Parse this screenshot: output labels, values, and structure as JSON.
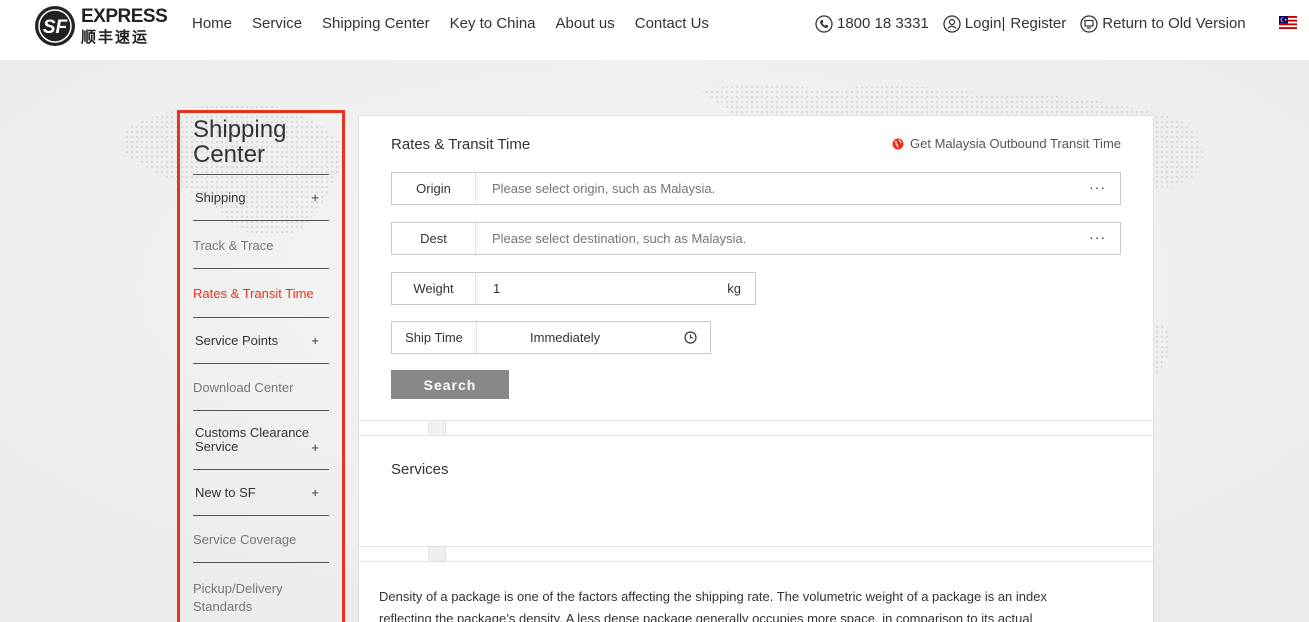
{
  "header": {
    "logo": {
      "en": "EXPRESS",
      "cn": "顺丰速运",
      "mark": "SF"
    },
    "nav": [
      "Home",
      "Service",
      "Shipping Center",
      "Key to China",
      "About us",
      "Contact Us"
    ],
    "phone": "1800 18 3331",
    "login": "Login|",
    "register": "Register",
    "old_version": "Return to Old Version",
    "icons": {
      "phone": "phone-icon",
      "user": "user-icon",
      "old": "monitor-icon",
      "flag": "malaysia-flag-icon"
    }
  },
  "sidebar": {
    "title": "Shipping Center",
    "items": [
      {
        "label": "Shipping",
        "plus": "+",
        "style": "dark"
      },
      {
        "label": "Track & Trace",
        "plus": "",
        "style": "grey"
      },
      {
        "label": "Rates & Transit Time",
        "plus": "",
        "style": "active"
      },
      {
        "label": "Service Points",
        "plus": "+",
        "style": "dark"
      },
      {
        "label": "Download Center",
        "plus": "",
        "style": "grey"
      },
      {
        "label": "Customs Clearance Service",
        "plus": "+",
        "style": "dark"
      },
      {
        "label": "New to SF",
        "plus": "+",
        "style": "dark"
      },
      {
        "label": "Service Coverage",
        "plus": "",
        "style": "grey"
      },
      {
        "label": "Pickup/Delivery Standards",
        "plus": "",
        "style": "grey"
      }
    ],
    "highlight_color": "#e8321f"
  },
  "rates": {
    "title": "Rates & Transit Time",
    "outbound_link": "Get Malaysia Outbound Transit Time",
    "origin": {
      "label": "Origin",
      "placeholder": "Please select origin, such as Malaysia.",
      "more": "···"
    },
    "dest": {
      "label": "Dest",
      "placeholder": "Please select destination, such as Malaysia.",
      "more": "···"
    },
    "weight": {
      "label": "Weight",
      "value": "1",
      "unit": "kg"
    },
    "ship_time": {
      "label": "Ship Time",
      "value": "Immediately"
    },
    "search_label": "Search"
  },
  "services": {
    "title": "Services"
  },
  "description": {
    "lines": [
      "Density of a package is one of the factors affecting the shipping rate. The volumetric weight of a package is an index",
      "reflecting the package’s density. A less dense package generally occupies more space, in comparison to its actual"
    ]
  }
}
